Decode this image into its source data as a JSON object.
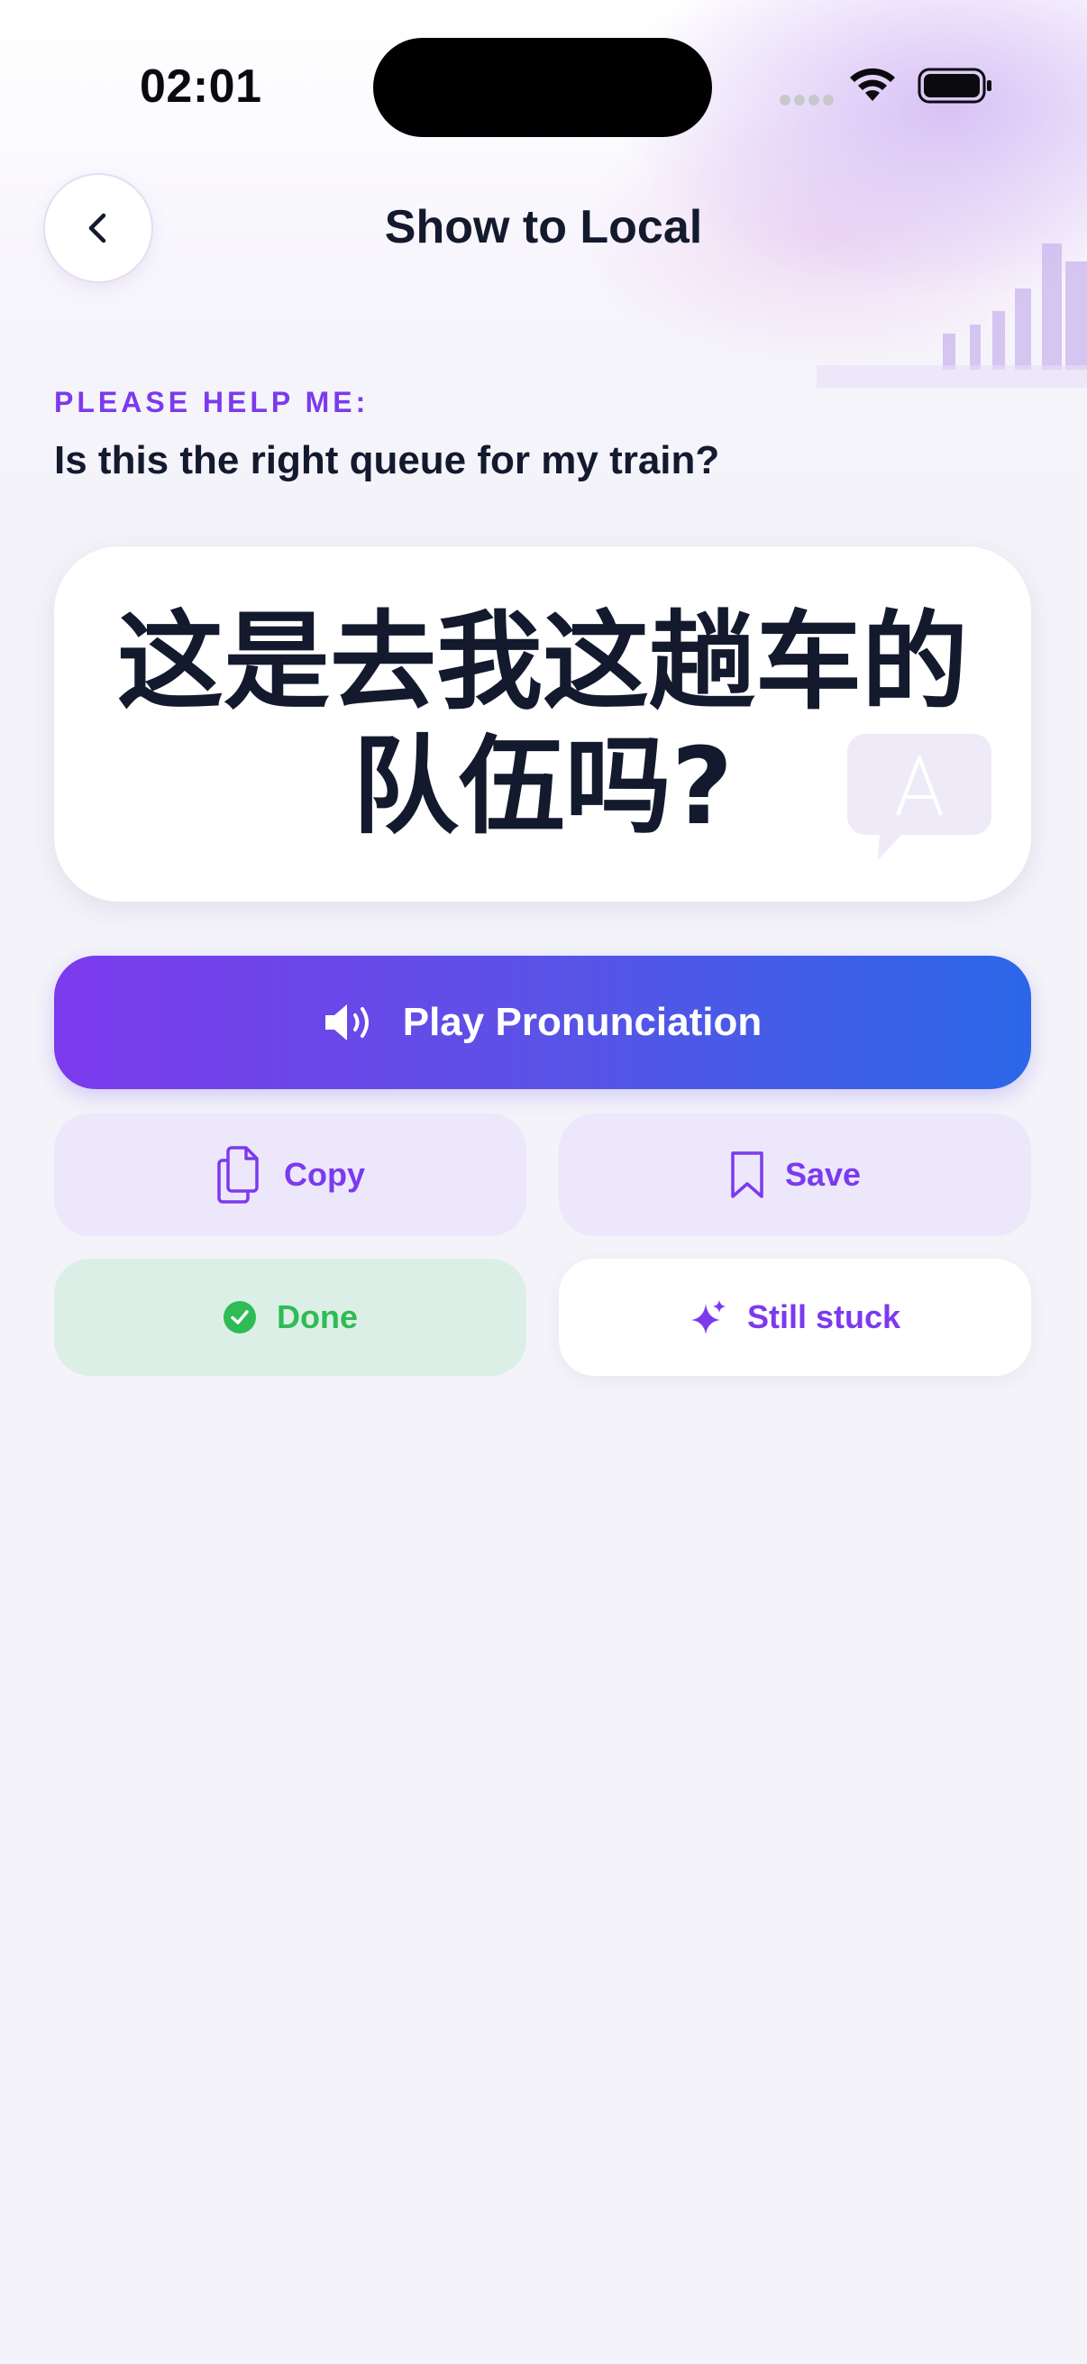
{
  "status_bar": {
    "time": "02:01"
  },
  "header": {
    "title": "Show to Local",
    "back_icon": "chevron-left-icon"
  },
  "request": {
    "label": "PLEASE HELP ME:",
    "source_text": "Is this the right queue for my train?",
    "translated_text": "这是去我这趟车的队伍吗?"
  },
  "actions": {
    "play_label": "Play Pronunciation",
    "copy_label": "Copy",
    "save_label": "Save",
    "done_label": "Done",
    "stuck_label": "Still stuck"
  },
  "colors": {
    "accent": "#7c3aed",
    "gradient_start": "#7c3aed",
    "gradient_end": "#2b67e8",
    "success": "#2fbb55",
    "background": "#f3f3f9"
  }
}
